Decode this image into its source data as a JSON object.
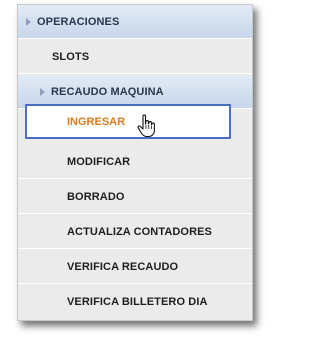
{
  "menu": {
    "header": "OPERACIONES",
    "slots": "SLOTS",
    "subheader": "RECAUDO MAQUINA",
    "active_item": "INGRESAR",
    "items": [
      "MODIFICAR",
      "BORRADO",
      "ACTUALIZA CONTADORES",
      "VERIFICA RECAUDO",
      "VERIFICA BILLETERO DIA"
    ]
  },
  "colors": {
    "header_bg": "#c7d6ea",
    "active_text": "#e07a1a",
    "active_border": "#4a6ec2"
  },
  "icons": {
    "cursor": "hand-pointer-icon",
    "expand": "triangle-right-icon"
  }
}
